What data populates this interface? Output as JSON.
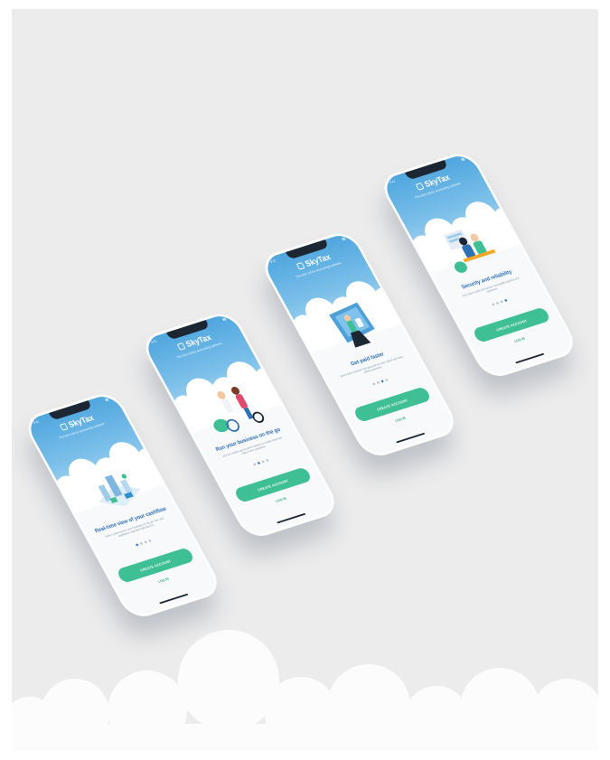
{
  "colors": {
    "background": "#ececec",
    "sky_top": "#4fa6de",
    "title_blue": "#2f6fb3",
    "button_green": "#3fbf94"
  },
  "phones": [
    {
      "time": "9:41",
      "brand": "SkyTax",
      "tagline": "The best online accounting software",
      "title": "Real-time view of your cashflow",
      "description": "Keep a close eye on your business on the go. See your cashflow in real-time with SkyTax.",
      "active_page": 1,
      "cta": "CREATE ACCOUNT",
      "login": "LOG IN",
      "illustration": "isometric-city-illustration"
    },
    {
      "time": "9:41",
      "brand": "SkyTax",
      "tagline": "The best online accounting software",
      "title": "Run your business on the go",
      "description": "Use our mobile app to send invoices or create expenses claims from anywhere.",
      "active_page": 2,
      "cta": "CREATE ACCOUNT",
      "login": "LOG IN",
      "illustration": "people-with-bikes-illustration"
    },
    {
      "time": "9:41",
      "brand": "SkyTax",
      "tagline": "The best online accounting software",
      "title": "Get paid faster",
      "description": "Send online invoices and get paid via card. Quick and easy online payments.",
      "active_page": 3,
      "cta": "CREATE ACCOUNT",
      "login": "LOG IN",
      "illustration": "person-on-phone-illustration"
    },
    {
      "time": "9:41",
      "brand": "SkyTax",
      "tagline": "The best online accounting software",
      "title": "Security and reliability",
      "description": "Your data is safe and secure. Accessible anytime and anywhere.",
      "active_page": 4,
      "cta": "CREATE ACCOUNT",
      "login": "LOG IN",
      "illustration": "people-on-bench-illustration"
    }
  ]
}
